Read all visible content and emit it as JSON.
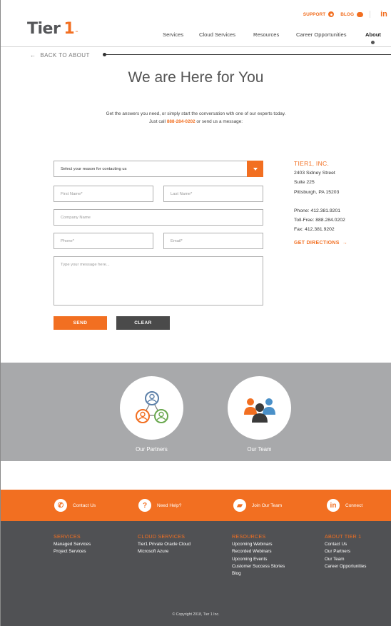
{
  "header": {
    "support_label": "SUPPORT",
    "blog_label": "BLOG",
    "linkedin_label": "in",
    "logo_text": "Tier",
    "logo_mark": "1",
    "nav": [
      "Services",
      "Cloud Services",
      "Resources",
      "Career Opportunities",
      "About"
    ],
    "active_nav": "About"
  },
  "back": {
    "label": "BACK TO ABOUT"
  },
  "hero": {
    "title": "We are Here for You",
    "intro_line1": "Get the answers you need, or simply start the conversation with one of our experts today.",
    "intro_pre": "Just call ",
    "intro_phone": "888-284-0202",
    "intro_post": " or send us a message:"
  },
  "form": {
    "reason_value": "Select your reason for contacting us",
    "first_name_placeholder": "First Name*",
    "last_name_placeholder": "Last Name*",
    "company_placeholder": "Company Name",
    "phone_placeholder": "Phone*",
    "email_placeholder": "Email*",
    "message_placeholder": "Type your message here...",
    "send_label": "SEND",
    "clear_label": "CLEAR"
  },
  "address": {
    "company": "TIER1, INC.",
    "street": "2403 Sidney Street",
    "suite": "Suite 225",
    "city": "Pittsburgh, PA 15203",
    "phone": "Phone: 412.381.9201",
    "tollfree": "Toll-Free: 888.284.0202",
    "fax": "Fax: 412.381.9202",
    "directions": "GET DIRECTIONS"
  },
  "band": {
    "partners_label": "Our Partners",
    "team_label": "Our Team"
  },
  "orange_bar": {
    "items": [
      "Contact Us",
      "Need Help?",
      "Join Our Team",
      "Connect"
    ]
  },
  "footer": {
    "columns": [
      {
        "heading": "SERVICES",
        "links": [
          "Managed Services",
          "Project Services"
        ]
      },
      {
        "heading": "CLOUD SERVICES",
        "links": [
          "Tier1 Private Oracle Cloud",
          "Microsoft Azure"
        ]
      },
      {
        "heading": "RESOURCES",
        "links": [
          "Upcoming Webinars",
          "Recorded Webinars",
          "Upcoming Events",
          "Customer Success Stories",
          "Blog"
        ]
      },
      {
        "heading": "ABOUT TIER 1",
        "links": [
          "Contact Us",
          "Our Partners",
          "Our Team",
          "Career Opportunities"
        ]
      }
    ],
    "copyright": "© Copyright 2018, Tier 1 Inc."
  },
  "colors": {
    "accent": "#f26f21",
    "band": "#a8a9ab",
    "footer": "#505154"
  }
}
